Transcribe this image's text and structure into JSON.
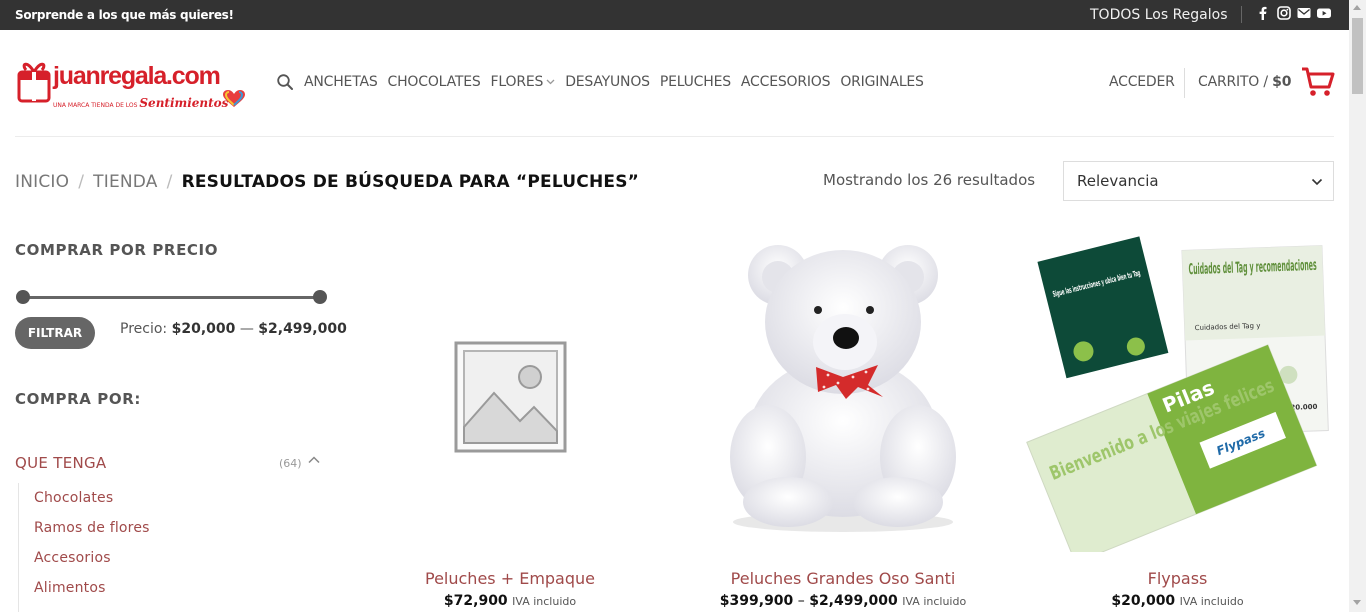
{
  "topbar": {
    "promo": "Sorprende a los que más quieres!",
    "all_gifts": "TODOS Los Regalos",
    "social_icons": [
      "facebook-icon",
      "instagram-icon",
      "email-icon",
      "youtube-icon"
    ]
  },
  "header": {
    "logo_text": "juanregala.com",
    "logo_tagline_prefix": "UNA MARCA TIENDA DE LOS",
    "logo_tagline_script": "Sentimientos",
    "nav": [
      {
        "label": "ANCHETAS"
      },
      {
        "label": "CHOCOLATES"
      },
      {
        "label": "FLORES"
      },
      {
        "label": "DESAYUNOS"
      },
      {
        "label": "PELUCHES"
      },
      {
        "label": "ACCESORIOS"
      },
      {
        "label": "ORIGINALES"
      }
    ],
    "login": "ACCEDER",
    "cart_label": "CARRITO",
    "cart_sep": "/",
    "cart_total": "$0"
  },
  "breadcrumb": {
    "home": "INICIO",
    "sep1": "/",
    "shop": "TIENDA",
    "sep2": "/",
    "current": "RESULTADOS DE BÚSQUEDA PARA “PELUCHES”"
  },
  "results": {
    "count_text": "Mostrando los 26 resultados",
    "orderby_value": "Relevancia"
  },
  "sidebar": {
    "price_title": "COMPRAR POR PRECIO",
    "filter_button": "FILTRAR",
    "price_prefix": "Precio:",
    "price_min": "$20,000",
    "price_dash": "—",
    "price_max": "$2,499,000",
    "buy_by_title": "COMPRA POR:",
    "category_parent": "QUE TENGA",
    "category_count": "(64)",
    "categories": [
      {
        "label": "Chocolates"
      },
      {
        "label": "Ramos de flores"
      },
      {
        "label": "Accesorios"
      },
      {
        "label": "Alimentos"
      }
    ]
  },
  "products": [
    {
      "name": "Peluches + Empaque",
      "price": "$72,900",
      "price_dash": "",
      "price_max": "",
      "tax": "IVA incluido"
    },
    {
      "name": "Peluches Grandes Oso Santi",
      "price": "$399,900",
      "price_dash": "–",
      "price_max": "$2,499,000",
      "tax": "IVA incluido"
    },
    {
      "name": "Flypass",
      "price": "$20,000",
      "price_dash": "",
      "price_max": "",
      "tax": "IVA incluido"
    }
  ],
  "flypass_art": {
    "card1": "Sigue las instrucciones y ubica bien tu Tag",
    "card2": "Cuidados del Tag y recomendaciones",
    "card2_sub": "Cuidados del Tag y",
    "card3": "Pilas",
    "card4": "Bienvenido a los viajes felices",
    "brand": "Flypass",
    "price_tag": "$20.000"
  },
  "colors": {
    "accent": "#d6202a",
    "link": "#a04a4a",
    "topbar": "#333333"
  }
}
